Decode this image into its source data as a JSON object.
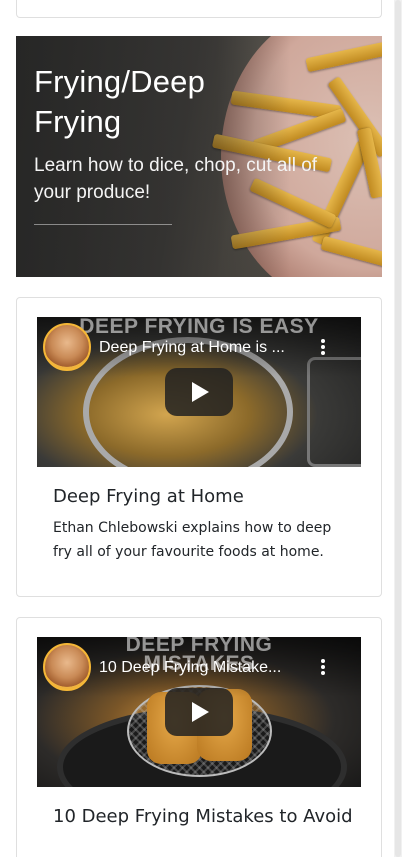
{
  "hero": {
    "title": "Frying/Deep Frying",
    "subtitle": "Learn how to dice, chop, cut all of your produce!"
  },
  "videos": [
    {
      "overlay_text": "DEEP FRYING IS EASY",
      "video_title": "Deep Frying at Home is ...",
      "card_title": "Deep Frying at Home",
      "card_text": "Ethan Chlebowski explains how to deep fry all of your favourite foods at home."
    },
    {
      "overlay_text": "DEEP FRYING MISTAKES",
      "video_title": "10 Deep Frying Mistake...",
      "card_title": "10 Deep Frying Mistakes to Avoid",
      "card_text": ""
    }
  ],
  "colors": {
    "accent_avatar_ring": "#f5b737",
    "card_border": "#dfdfdf",
    "text": "#212529"
  },
  "icons": [
    "play-icon",
    "more-vert-icon",
    "channel-avatar-icon"
  ]
}
